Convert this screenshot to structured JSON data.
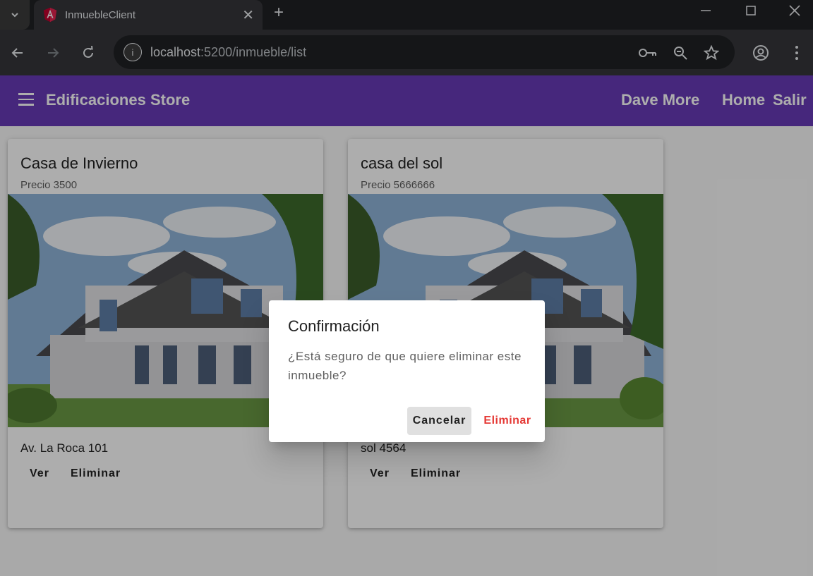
{
  "browser": {
    "tab_title": "InmuebleClient",
    "url_host": "localhost",
    "url_path": ":5200/inmueble/list"
  },
  "app": {
    "title": "Edificaciones Store",
    "nav": {
      "user": "Dave More",
      "home": "Home",
      "logout": "Salir"
    }
  },
  "cards": [
    {
      "title": "Casa de Invierno",
      "price": "Precio 3500",
      "address": "Av. La Roca 101",
      "view_label": "Ver",
      "delete_label": "Eliminar"
    },
    {
      "title": "casa del sol",
      "price": "Precio 5666666",
      "address": "sol 4564",
      "view_label": "Ver",
      "delete_label": "Eliminar"
    }
  ],
  "dialog": {
    "title": "Confirmación",
    "message": "¿Está seguro de que quiere eliminar este inmueble?",
    "cancel_label": "Cancelar",
    "delete_label": "Eliminar"
  },
  "colors": {
    "primary": "#673ab7",
    "warn": "#e53935",
    "browser_dark": "#202124"
  }
}
